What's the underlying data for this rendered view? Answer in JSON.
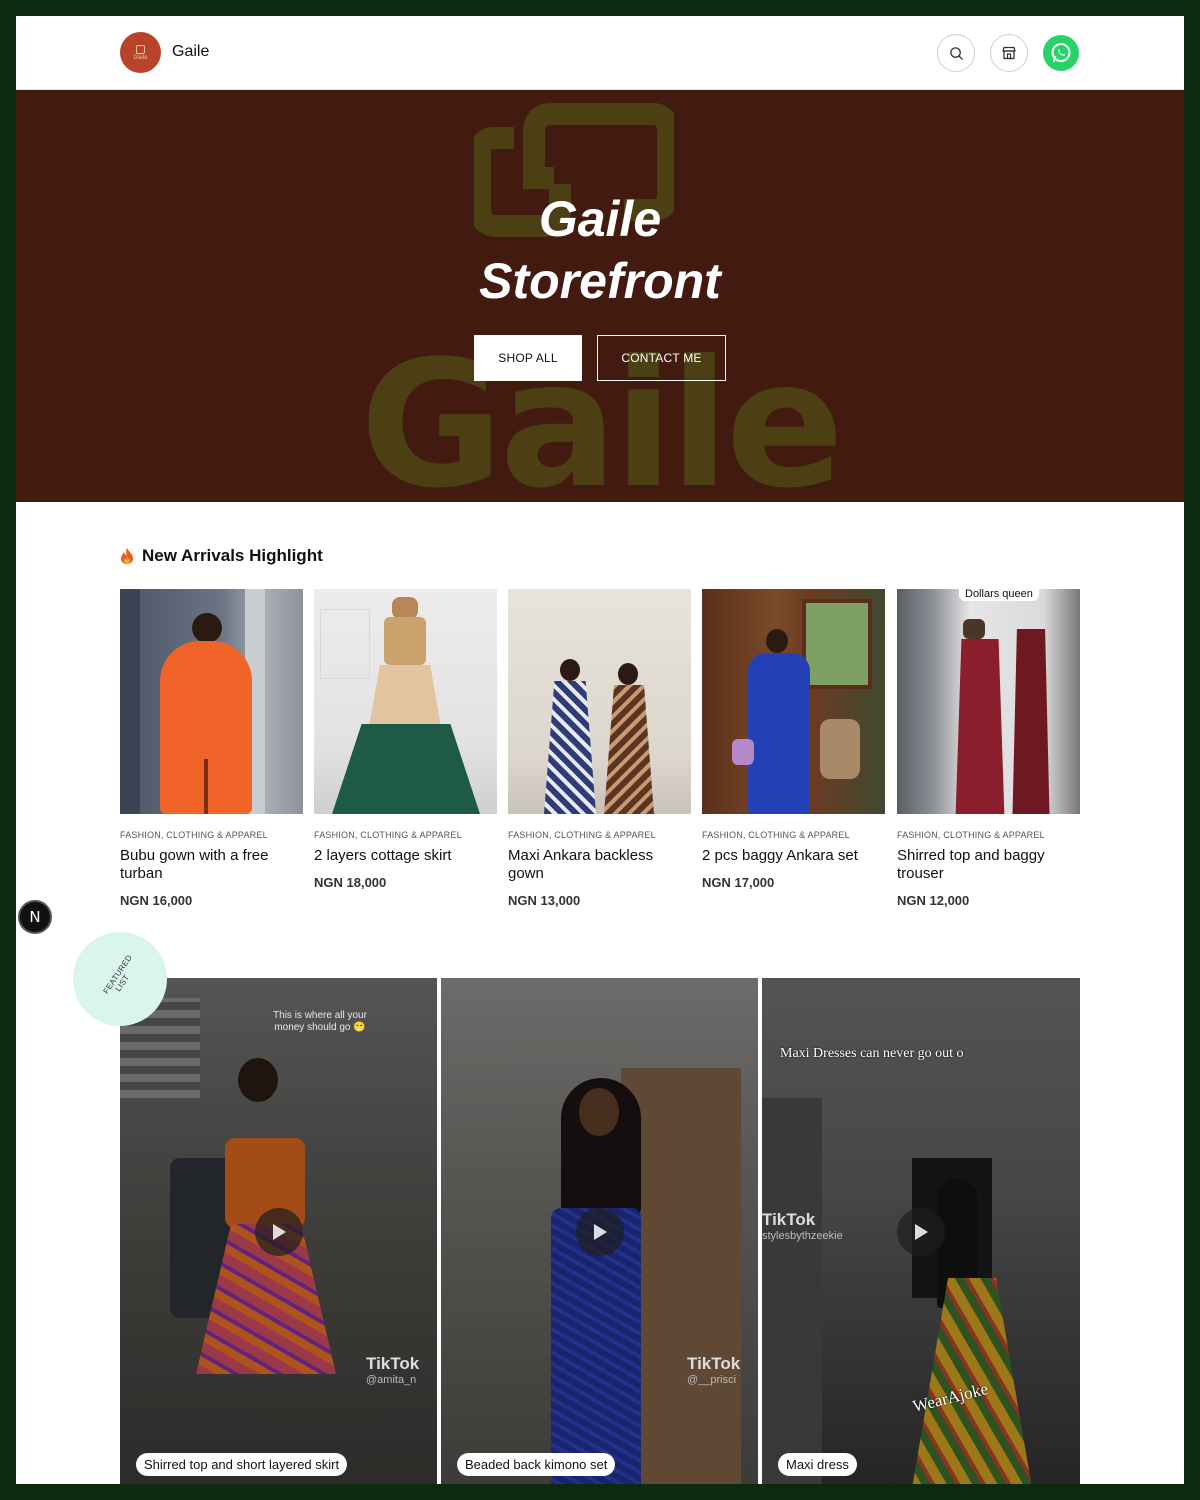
{
  "header": {
    "logo_text": "Gaile",
    "brand_name": "Gaile",
    "icons": [
      "search-icon",
      "store-icon",
      "whatsapp-icon"
    ]
  },
  "hero": {
    "title_line1": "Gaile",
    "title_line2": "Storefront",
    "watermark": "Gaile",
    "shop_all_label": "SHOP ALL",
    "contact_label": "CONTACT ME",
    "background_color": "#431a10"
  },
  "new_arrivals": {
    "title": "New Arrivals Highlight",
    "icon": "fire-icon",
    "products": [
      {
        "category": "FASHION, CLOTHING & APPAREL",
        "name": "Bubu gown with a free turban",
        "price": "NGN 16,000"
      },
      {
        "category": "FASHION, CLOTHING & APPAREL",
        "name": "2 layers cottage skirt",
        "price": "NGN 18,000"
      },
      {
        "category": "FASHION, CLOTHING & APPAREL",
        "name": "Maxi Ankara backless gown",
        "price": "NGN 13,000"
      },
      {
        "category": "FASHION, CLOTHING & APPAREL",
        "name": "2 pcs baggy Ankara set",
        "price": "NGN 17,000"
      },
      {
        "category": "FASHION, CLOTHING & APPAREL",
        "name": "Shirred top and baggy trouser",
        "price": "NGN 12,000",
        "image_text": "Dollars queen"
      }
    ]
  },
  "floating_badge": "N",
  "featured": {
    "badge_line1": "FEATURED",
    "badge_line2": "LIST",
    "videos": [
      {
        "caption": "Shirred top and short layered skirt",
        "overlay_text": "This is where all your money should go 😁",
        "tiktok": "TikTok",
        "handle": "@amita_n"
      },
      {
        "caption": "Beaded back kimono set",
        "tiktok": "TikTok",
        "handle": "@__prisci"
      },
      {
        "caption": "Maxi dress",
        "overlay_text": "Maxi Dresses can never go out o",
        "tiktok": "TikTok",
        "handle": "stylesbythzeekie",
        "watermark": "WearAjoke"
      }
    ]
  }
}
